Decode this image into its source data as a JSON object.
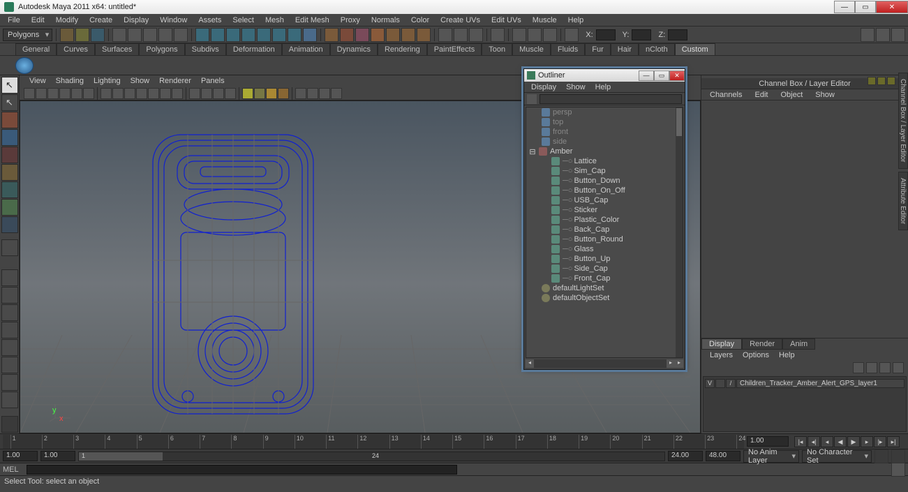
{
  "window": {
    "title": "Autodesk Maya 2011 x64: untitled*"
  },
  "main_menu": [
    "File",
    "Edit",
    "Modify",
    "Create",
    "Display",
    "Window",
    "Assets",
    "Select",
    "Mesh",
    "Edit Mesh",
    "Proxy",
    "Normals",
    "Color",
    "Create UVs",
    "Edit UVs",
    "Muscle",
    "Help"
  ],
  "mode_selector": "Polygons",
  "coord": {
    "x": "X:",
    "y": "Y:",
    "z": "Z:"
  },
  "shelf_tabs": [
    "General",
    "Curves",
    "Surfaces",
    "Polygons",
    "Subdivs",
    "Deformation",
    "Animation",
    "Dynamics",
    "Rendering",
    "PaintEffects",
    "Toon",
    "Muscle",
    "Fluids",
    "Fur",
    "Hair",
    "nCloth",
    "Custom"
  ],
  "shelf_active": "Custom",
  "panel_menu": [
    "View",
    "Shading",
    "Lighting",
    "Show",
    "Renderer",
    "Panels"
  ],
  "channel_box": {
    "title": "Channel Box / Layer Editor",
    "tabs": [
      "Channels",
      "Edit",
      "Object",
      "Show"
    ],
    "display_tabs": [
      "Display",
      "Render",
      "Anim"
    ],
    "display_active": "Display",
    "layer_menu": [
      "Layers",
      "Options",
      "Help"
    ],
    "layer": {
      "vis": "V",
      "slash": "/",
      "name": "Children_Tracker_Amber_Alert_GPS_layer1"
    }
  },
  "side_tabs": [
    "Channel Box / Layer Editor",
    "Attribute Editor"
  ],
  "outliner": {
    "title": "Outliner",
    "menu": [
      "Display",
      "Show",
      "Help"
    ],
    "cameras": [
      "persp",
      "top",
      "front",
      "side"
    ],
    "group": "Amber",
    "children": [
      "Lattice",
      "Sim_Cap",
      "Button_Down",
      "Button_On_Off",
      "USB_Cap",
      "Sticker",
      "Plastic_Color",
      "Back_Cap",
      "Button_Round",
      "Glass",
      "Button_Up",
      "Side_Cap",
      "Front_Cap"
    ],
    "sets": [
      "defaultLightSet",
      "defaultObjectSet"
    ]
  },
  "timeline": {
    "ticks": [
      "1",
      "2",
      "3",
      "4",
      "5",
      "6",
      "7",
      "8",
      "9",
      "10",
      "11",
      "12",
      "13",
      "14",
      "15",
      "16",
      "17",
      "18",
      "19",
      "20",
      "21",
      "22",
      "23",
      "24"
    ],
    "start": "1.00",
    "playstart": "1.00",
    "range_from": "1",
    "range_to": "24",
    "playend": "24.00",
    "end": "48.00",
    "fps": "1.00",
    "anim_layer": "No Anim Layer",
    "char_set": "No Character Set"
  },
  "mel": {
    "label": "MEL"
  },
  "status": "Select Tool: select an object"
}
